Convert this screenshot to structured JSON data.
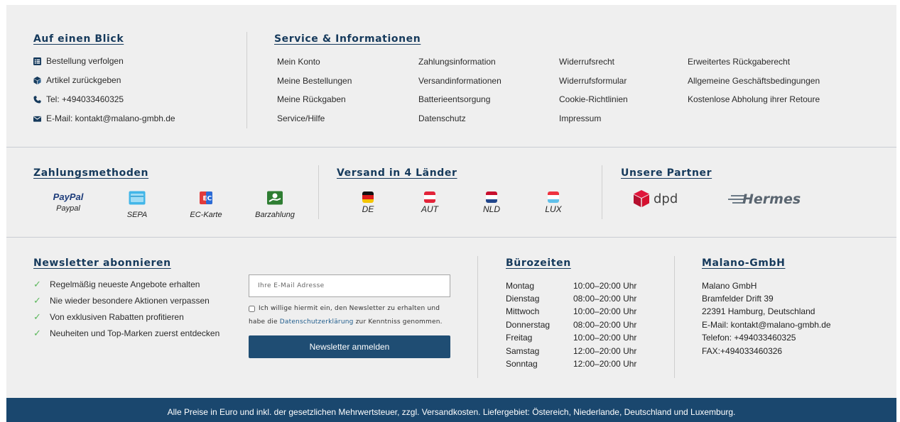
{
  "glance": {
    "title": "Auf einen Blick",
    "items": [
      {
        "icon": "list-icon",
        "label": "Bestellung verfolgen"
      },
      {
        "icon": "box-icon",
        "label": "Artikel zurückgeben"
      },
      {
        "icon": "phone-icon",
        "label": "Tel: +494033460325"
      },
      {
        "icon": "envelope-icon",
        "label": "E-Mail: kontakt@malano-gmbh.de"
      }
    ]
  },
  "service": {
    "title": "Service & Informationen",
    "columns": [
      [
        "Mein Konto",
        "Meine Bestellungen",
        "Meine Rückgaben",
        "Service/Hilfe"
      ],
      [
        "Zahlungsinformation",
        "Versandinformationen",
        "Batterieentsorgung",
        "Datenschutz"
      ],
      [
        "Widerrufsrecht",
        "Widerrufsformular",
        "Cookie-Richtlinien",
        "Impressum"
      ],
      [
        "Erweitertes Rückgaberecht",
        "Allgemeine Geschäftsbedingungen",
        "Kostenlose Abholung ihrer Retoure"
      ]
    ]
  },
  "payment": {
    "title": "Zahlungsmethoden",
    "paypal_logo": "PayPal",
    "methods": [
      "Paypal",
      "SEPA",
      "EC-Karte",
      "Barzahlung"
    ]
  },
  "shipping": {
    "title": "Versand in 4 Länder",
    "countries": [
      "DE",
      "AUT",
      "NLD",
      "LUX"
    ]
  },
  "partners": {
    "title": "Unsere Partner",
    "items": [
      "dpd",
      "Hermes"
    ]
  },
  "newsletter": {
    "title": "Newsletter abonnieren",
    "benefits": [
      "Regelmäßig neueste Angebote erhalten",
      "Nie wieder besondere Aktionen verpassen",
      "Von exklusiven Rabatten profitieren",
      "Neuheiten und Top-Marken zuerst entdecken"
    ],
    "email_placeholder": "Ihre E-Mail Adresse",
    "consent_line1": "Ich willige hiermit ein, den Newsletter zu erhalten und",
    "consent_prefix": "habe die ",
    "consent_link": "Datenschutzerklärung",
    "consent_suffix": " zur Kenntniss genommen.",
    "button": "Newsletter anmelden"
  },
  "hours": {
    "title": "Bürozeiten",
    "rows": [
      {
        "day": "Montag",
        "time": "10:00–20:00 Uhr"
      },
      {
        "day": "Dienstag",
        "time": "08:00–20:00 Uhr"
      },
      {
        "day": "Mittwoch",
        "time": "10:00–20:00 Uhr"
      },
      {
        "day": "Donnerstag",
        "time": "08:00–20:00 Uhr"
      },
      {
        "day": "Freitag",
        "time": "10:00–20:00 Uhr"
      },
      {
        "day": "Samstag",
        "time": "12:00–20:00 Uhr"
      },
      {
        "day": "Sonntag",
        "time": "12:00–20:00 Uhr"
      }
    ]
  },
  "company": {
    "title": "Malano-GmbH",
    "lines": [
      "Malano GmbH",
      "Bramfelder Drift 39",
      "22391 Hamburg, Deutschland",
      "E-Mail: kontakt@malano-gmbh.de",
      "Telefon: +494033460325",
      "FAX:+494033460326"
    ]
  },
  "footer_note": "Alle Preise in Euro und inkl. der gesetzlichen Mehrwertsteuer, zzgl. Versandkosten. Liefergebiet: Östereich, Niederlande, Deutschland und Luxemburg.",
  "colors": {
    "accent": "#163a5c",
    "bar": "#1a476e",
    "check": "#5cb85c"
  }
}
